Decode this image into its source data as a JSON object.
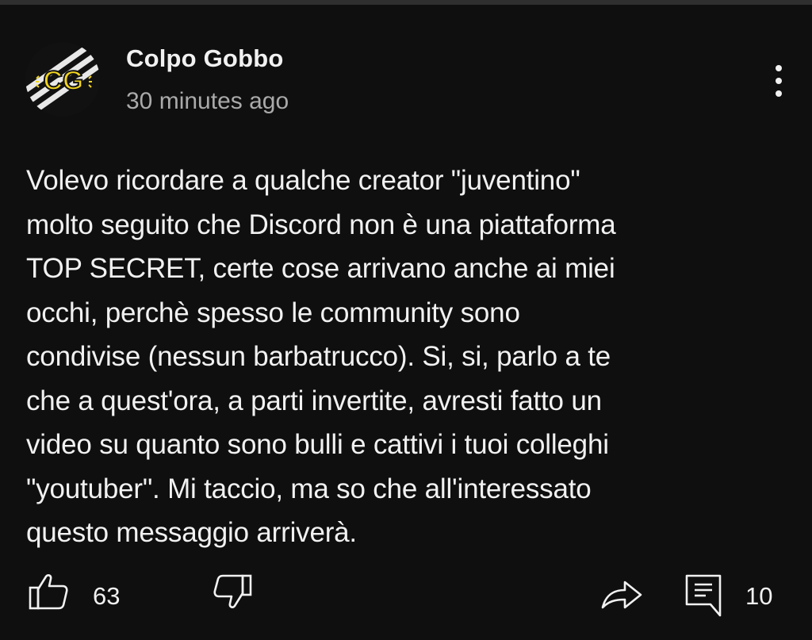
{
  "post": {
    "channel_name": "Colpo Gobbo",
    "avatar_text": "CG",
    "timestamp": "30 minutes ago",
    "body": "Volevo ricordare a qualche creator \"juventino\"\nmolto seguito che Discord non è una piattaforma\nTOP SECRET, certe cose arrivano anche ai miei\nocchi, perchè spesso le community sono\ncondivise (nessun barbatrucco). Si, si, parlo a te\nche a quest'ora, a parti invertite, avresti fatto un\nvideo su quanto sono bulli e cattivi i tuoi colleghi\n\"youtuber\". Mi taccio, ma so che all'interessato\nquesto messaggio arriverà.",
    "like_count": "63",
    "comment_count": "10"
  },
  "icons": {
    "more": "more-vertical-icon",
    "like": "thumbs-up-icon",
    "dislike": "thumbs-down-icon",
    "share": "share-arrow-icon",
    "comment": "comment-icon"
  },
  "colors": {
    "background": "#0f0f0f",
    "text": "#f1f1f1",
    "secondary_text": "#aaaaaa",
    "avatar_accent": "#f2d51f"
  }
}
